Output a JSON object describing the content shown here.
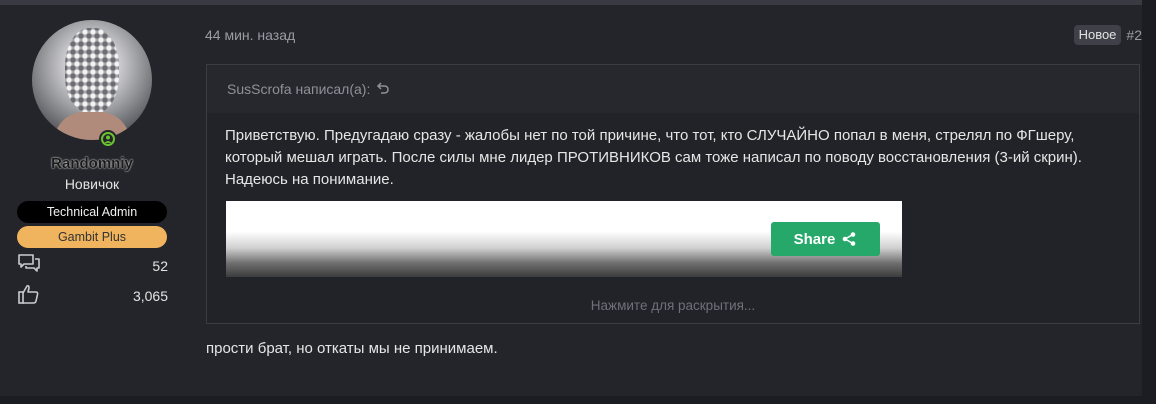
{
  "user": {
    "username": "Randomniy",
    "title": "Новичок",
    "banners": [
      "Technical Admin",
      "Gambit Plus"
    ],
    "stats": [
      {
        "icon": "messages-icon",
        "value": "52"
      },
      {
        "icon": "reactions-thumbs-up-icon",
        "value": "3,065"
      }
    ],
    "online": true
  },
  "message": {
    "date": "44 мин. назад",
    "new_badge": "Новое",
    "post_number": "#2",
    "quote": {
      "author": "SusScrofa написал(а):",
      "text": "Приветствую. Предугадаю сразу - жалобы нет по той причине, что тот, кто СЛУЧАЙНО попал в меня, стрелял по ФГшеру, который мешал играть. После силы мне лидер ПРОТИВНИКОВ сам тоже написал по поводу восстановления (3-ий скрин). Надеюсь на понимание.",
      "embed_button": "Share",
      "expand_label": "Нажмите для раскрытия..."
    },
    "reply_text": "прости брат, но откаты мы не принимаем."
  },
  "colors": {
    "page_bg": "#1c1d22",
    "post_bg": "#24252b",
    "quote_border": "#3c3d44",
    "admin_banner": "#000000",
    "gambit_banner": "#f0b45e",
    "online_green": "#6ac22f",
    "share_green": "#26a86a"
  }
}
